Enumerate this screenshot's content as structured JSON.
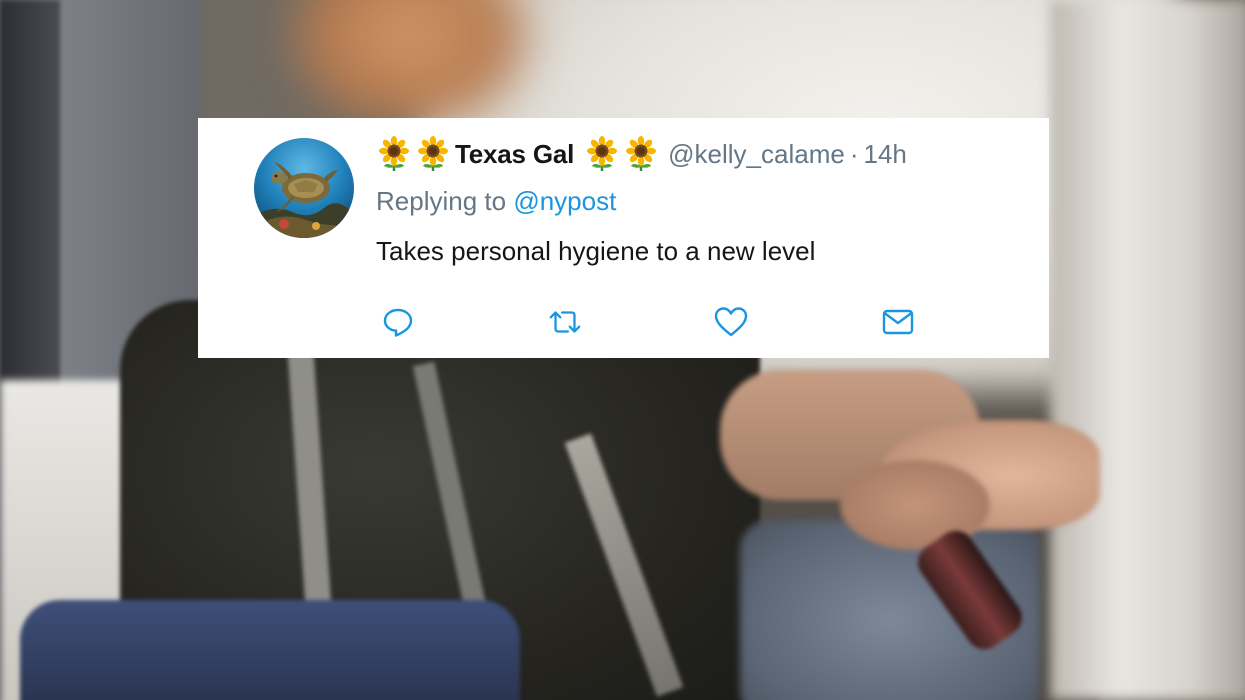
{
  "tweet": {
    "display_name": "Texas Gal",
    "name_emoji_left": "sunflower-icon sunflower-icon",
    "name_emoji_right": "sunflower-icon sunflower-icon",
    "handle": "@kelly_calame",
    "separator": "·",
    "timestamp": "14h",
    "replying_prefix": "Replying to",
    "replying_to": "@nypost",
    "text": "Takes personal hygiene to a new level",
    "avatar": "sea-turtle-avatar",
    "actions": {
      "reply": "reply-icon",
      "retweet": "retweet-icon",
      "like": "heart-icon",
      "message": "envelope-icon"
    }
  },
  "colors": {
    "card_background": "#ffffff",
    "name_text": "#14171a",
    "secondary_text": "#657786",
    "mention_link": "#1b95e0"
  }
}
